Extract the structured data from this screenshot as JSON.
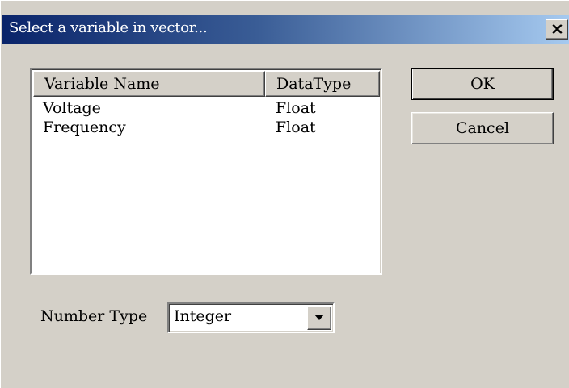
{
  "window": {
    "title": "Select a variable in vector...",
    "close_icon": "close-icon"
  },
  "list": {
    "columns": [
      "Variable Name",
      "DataType"
    ],
    "rows": [
      {
        "name": "Voltage",
        "type": "Float"
      },
      {
        "name": "Frequency",
        "type": "Float"
      }
    ]
  },
  "buttons": {
    "ok_label": "OK",
    "cancel_label": "Cancel"
  },
  "number_type": {
    "label": "Number Type",
    "value": "Integer",
    "dropdown_icon": "chevron-down-icon"
  },
  "colors": {
    "title_gradient_start": "#0a246a",
    "title_gradient_end": "#a6caf0",
    "face": "#d4d0c8"
  }
}
